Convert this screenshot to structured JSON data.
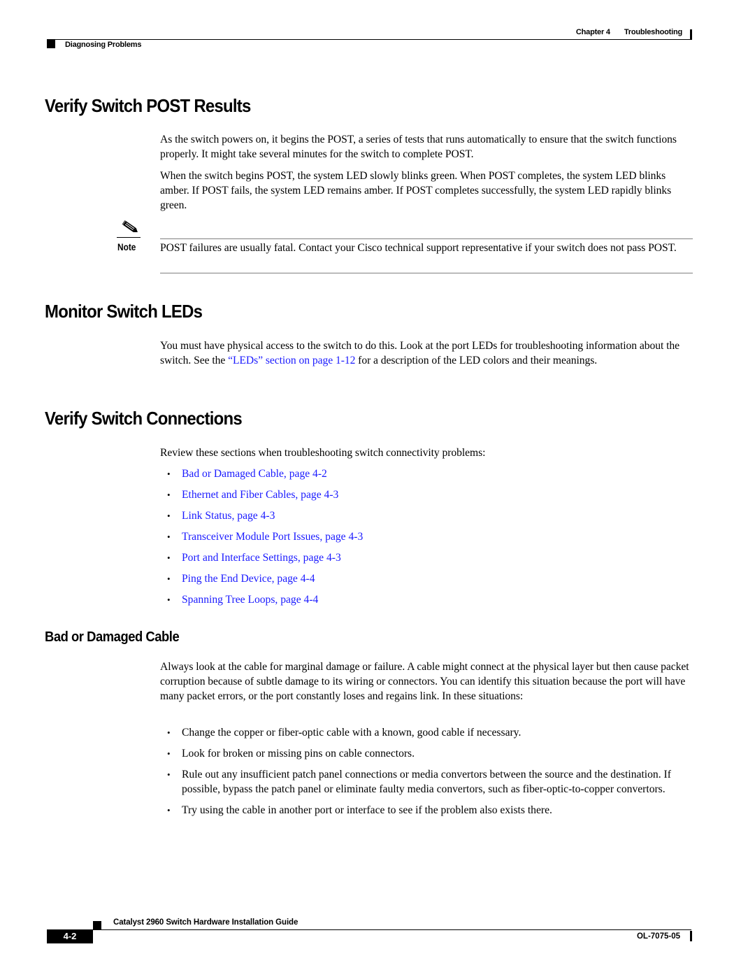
{
  "header": {
    "chapter_label": "Chapter 4",
    "chapter_title": "Troubleshooting",
    "section": "Diagnosing Problems"
  },
  "sections": {
    "post": {
      "heading": "Verify Switch POST Results",
      "para1": "As the switch powers on, it begins the POST, a series of tests that runs automatically to ensure that the switch functions properly. It might take several minutes for the switch to complete POST.",
      "para2": "When the switch begins POST, the system LED slowly blinks green. When POST completes, the system LED blinks amber. If POST fails, the system LED remains amber. If POST completes successfully, the system LED rapidly blinks green.",
      "note": {
        "icon": "pencil-note-icon",
        "label": "Note",
        "text": "POST failures are usually fatal. Contact your Cisco technical support representative if your switch does not pass POST."
      }
    },
    "leds": {
      "heading": "Monitor Switch LEDs",
      "para_before_link": "You must have physical access to the switch to do this. Look at the port LEDs for troubleshooting information about the switch. See the ",
      "link_text": "“LEDs” section on page 1-12",
      "para_after_link": " for a description of the LED colors and their meanings."
    },
    "connections": {
      "heading": "Verify Switch Connections",
      "intro": "Review these sections when troubleshooting switch connectivity problems:",
      "links": [
        "Bad or Damaged Cable, page 4-2",
        "Ethernet and Fiber Cables, page 4-3",
        "Link Status, page 4-3",
        "Transceiver Module Port Issues, page 4-3",
        "Port and Interface Settings, page 4-3",
        "Ping the End Device, page 4-4",
        "Spanning Tree Loops, page 4-4"
      ]
    },
    "bad_cable": {
      "heading": "Bad or Damaged Cable",
      "para": "Always look at the cable for marginal damage or failure. A cable might connect at the physical layer but then cause packet corruption because of subtle damage to its wiring or connectors. You can identify this situation because the port will have many packet errors, or the port constantly loses and regains link. In these situations:",
      "bullets": [
        "Change the copper or fiber-optic cable with a known, good cable if necessary.",
        "Look for broken or missing pins on cable connectors.",
        "Rule out any insufficient patch panel connections or media convertors between the source and the destination. If possible, bypass the patch panel or eliminate faulty media convertors, such as fiber-optic-to-copper convertors.",
        "Try using the cable in another port or interface to see if the problem also exists there."
      ]
    }
  },
  "footer": {
    "guide_title": "Catalyst 2960 Switch Hardware Installation Guide",
    "page_number": "4-2",
    "doc_number": "OL-7075-05"
  },
  "colors": {
    "link": "#1a1aff",
    "text": "#000000",
    "rule": "#808080"
  },
  "bullet_char": "•"
}
